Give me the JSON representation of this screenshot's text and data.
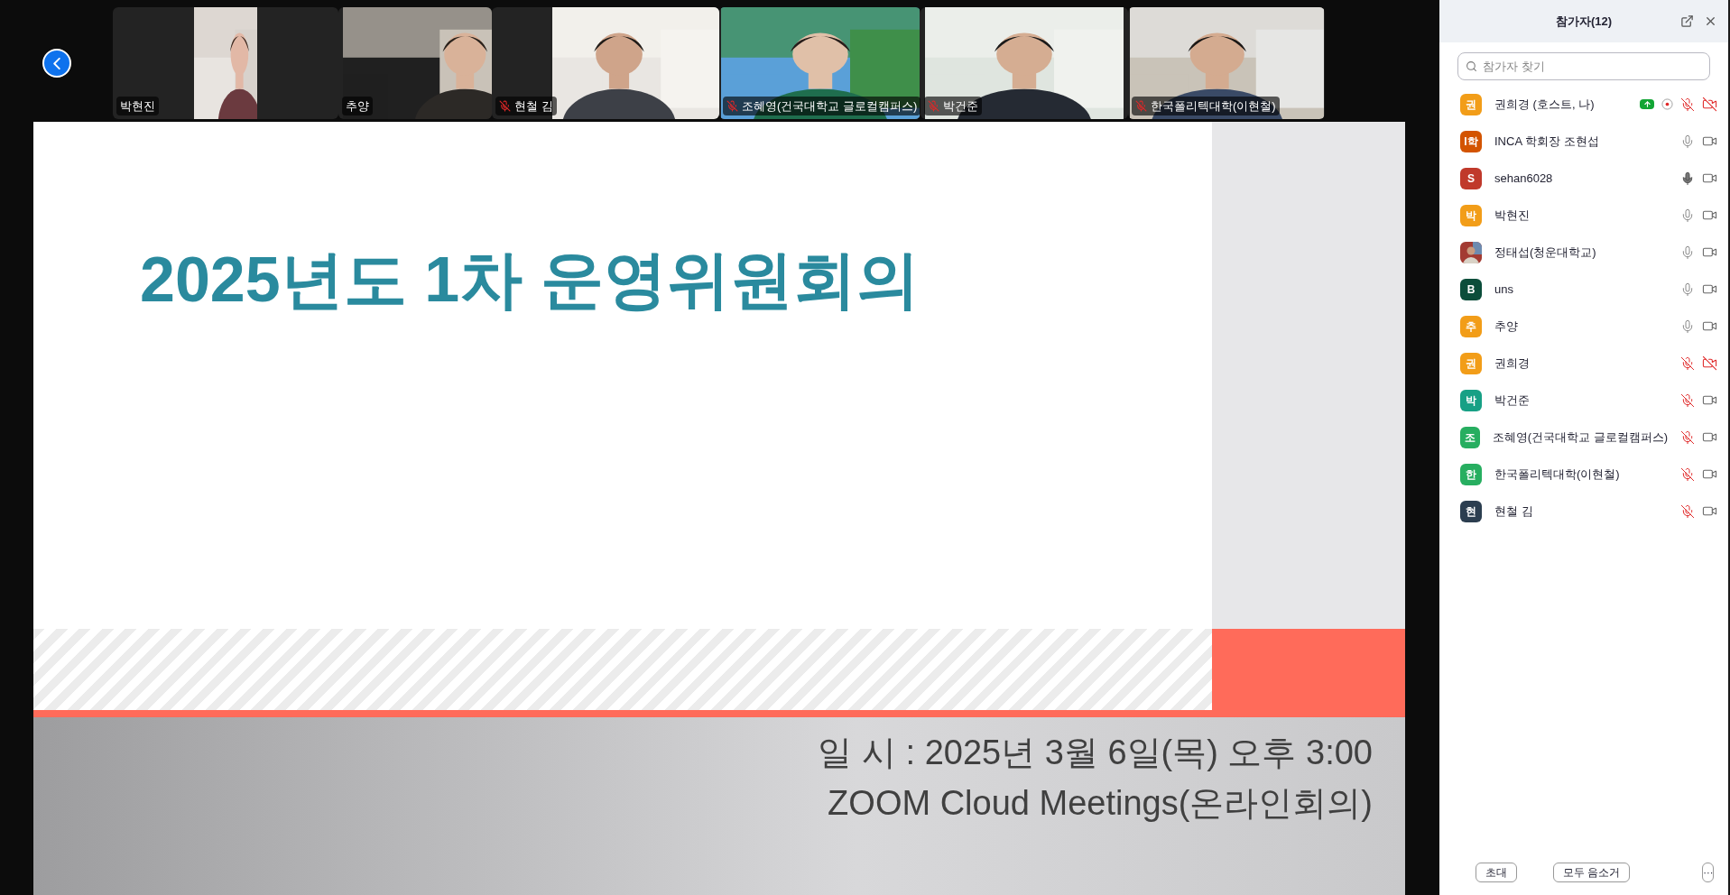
{
  "video_strip": {
    "tiles": [
      {
        "name": "박현진",
        "muted": false
      },
      {
        "name": "추양",
        "muted": false
      },
      {
        "name": "현철 김",
        "muted": true
      },
      {
        "name": "조혜영(건국대학교 글로컬캠퍼스)",
        "muted": true
      },
      {
        "name": "박건준",
        "muted": true
      },
      {
        "name": "한국폴리텍대학(이현철)",
        "muted": true
      }
    ]
  },
  "slide": {
    "title": "2025년도 1차 운영위원회의",
    "lines": [
      "일 시 : 2025년 3월 6일(목) 오후 3:00",
      "ZOOM Cloud Meetings(온라인회의)"
    ]
  },
  "participants_panel": {
    "title": "참가자(12)",
    "search": {
      "placeholder": "참가자 찾기"
    },
    "participants": [
      {
        "name": "권희경 (호스트, 나)",
        "avatar": {
          "kind": "letter",
          "letter": "권",
          "color": "#f29d18"
        },
        "sharing": true,
        "recording": true,
        "muted": true,
        "talking": false,
        "video_on": false
      },
      {
        "name": "INCA 학회장 조현섭",
        "avatar": {
          "kind": "letter",
          "letter": "I학",
          "color": "#d35400"
        },
        "sharing": false,
        "recording": false,
        "muted": false,
        "talking": false,
        "video_on": true
      },
      {
        "name": "sehan6028",
        "avatar": {
          "kind": "letter",
          "letter": "S",
          "color": "#c0392b"
        },
        "sharing": false,
        "recording": false,
        "muted": false,
        "talking": true,
        "video_on": true
      },
      {
        "name": "박현진",
        "avatar": {
          "kind": "letter",
          "letter": "박",
          "color": "#f29d18"
        },
        "sharing": false,
        "recording": false,
        "muted": false,
        "talking": false,
        "video_on": true
      },
      {
        "name": "정태섭(청운대학교)",
        "sharing": false,
        "recording": false,
        "muted": false,
        "talking": false,
        "video_on": true
      },
      {
        "name": "uns",
        "avatar": {
          "kind": "letter",
          "letter": "B",
          "color": "#0b4d3a"
        },
        "sharing": false,
        "recording": false,
        "muted": false,
        "talking": false,
        "video_on": true
      },
      {
        "name": "추양",
        "avatar": {
          "kind": "letter",
          "letter": "추",
          "color": "#f29d18"
        },
        "sharing": false,
        "recording": false,
        "muted": false,
        "talking": false,
        "video_on": true
      },
      {
        "name": "권희경",
        "avatar": {
          "kind": "letter",
          "letter": "권",
          "color": "#f29d18"
        },
        "sharing": false,
        "recording": false,
        "muted": true,
        "talking": false,
        "video_on": false
      },
      {
        "name": "박건준",
        "avatar": {
          "kind": "letter",
          "letter": "박",
          "color": "#17a085"
        },
        "sharing": false,
        "recording": false,
        "muted": true,
        "talking": false,
        "video_on": true
      },
      {
        "name": "조혜영(건국대학교 글로컬캠퍼스)",
        "avatar": {
          "kind": "letter",
          "letter": "조",
          "color": "#27ae60"
        },
        "sharing": false,
        "recording": false,
        "muted": true,
        "talking": false,
        "video_on": true
      },
      {
        "name": "한국폴리텍대학(이현철)",
        "avatar": {
          "kind": "letter",
          "letter": "한",
          "color": "#27ae60"
        },
        "sharing": false,
        "recording": false,
        "muted": true,
        "talking": false,
        "video_on": true
      },
      {
        "name": "현철 김",
        "avatar": {
          "kind": "letter",
          "letter": "현",
          "color": "#2c3e50"
        },
        "sharing": false,
        "recording": false,
        "muted": true,
        "talking": false,
        "video_on": true
      }
    ],
    "buttons": [
      "초대",
      "모두 음소거"
    ],
    "more_button": "···"
  }
}
